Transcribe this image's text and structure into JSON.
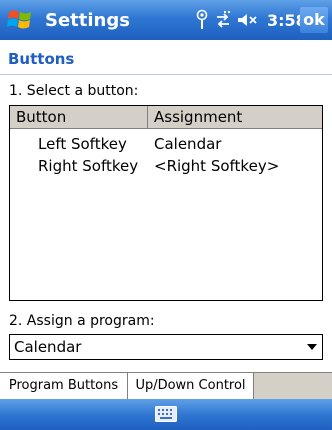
{
  "titlebar": {
    "title": "Settings",
    "time": "3:58",
    "ok_label": "ok",
    "icons": [
      "windows-start-icon",
      "antenna-icon",
      "connectivity-icon",
      "speaker-mute-icon"
    ]
  },
  "section": {
    "title": "Buttons"
  },
  "select_label": "1. Select a button:",
  "listview": {
    "columns": [
      "Button",
      "Assignment"
    ],
    "rows": [
      {
        "button": "Left Softkey",
        "assignment": "Calendar"
      },
      {
        "button": "Right Softkey",
        "assignment": "<Right Softkey>"
      }
    ]
  },
  "assign_label": "2. Assign a program:",
  "combo": {
    "value": "Calendar"
  },
  "tabs": [
    {
      "label": "Program Buttons",
      "active": true
    },
    {
      "label": "Up/Down Control",
      "active": false
    }
  ],
  "menubar": {
    "icon": "keyboard-icon"
  },
  "colors": {
    "titlebar": "#2f77d3",
    "section_title": "#1f5fbf"
  }
}
